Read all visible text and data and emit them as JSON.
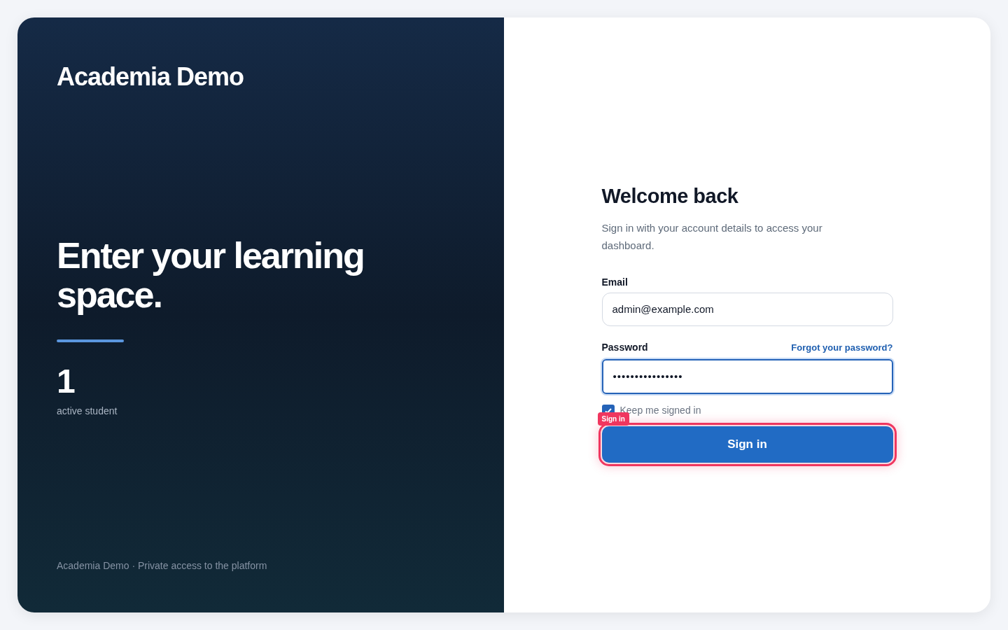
{
  "brand": "Academia Demo",
  "headline": "Enter your learning space.",
  "stat": {
    "value": "1",
    "label": "active student"
  },
  "footer": "Academia Demo · Private access to the platform",
  "form": {
    "title": "Welcome back",
    "subtitle": "Sign in with your account details to access your dashboard.",
    "email": {
      "label": "Email",
      "value": "admin@example.com"
    },
    "password": {
      "label": "Password",
      "value": "••••••••••••••••",
      "focused": true,
      "forgot_link": "Forgot your password?"
    },
    "remember": {
      "label": "Keep me signed in",
      "checked": true
    },
    "submit": {
      "label": "Sign in",
      "highlighted": true,
      "highlight_label": "Sign in"
    }
  }
}
